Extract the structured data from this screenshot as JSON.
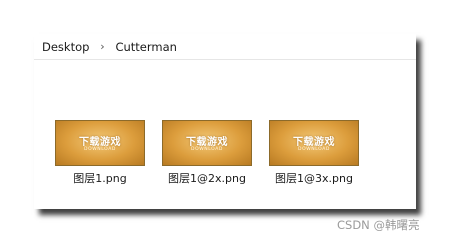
{
  "breadcrumb": {
    "items": [
      "Desktop",
      "Cutterman"
    ],
    "separator": "›"
  },
  "files": [
    {
      "name": "图层1.png",
      "thumb_title": "下载游戏",
      "thumb_subtitle": "DOWNLOAD"
    },
    {
      "name": "图层1@2x.png",
      "thumb_title": "下载游戏",
      "thumb_subtitle": "DOWNLOAD"
    },
    {
      "name": "图层1@3x.png",
      "thumb_title": "下载游戏",
      "thumb_subtitle": "DOWNLOAD"
    }
  ],
  "watermark": "CSDN @韩曙亮",
  "colors": {
    "thumb_gold": "#dc9d3c",
    "window_bg": "#ffffff"
  }
}
